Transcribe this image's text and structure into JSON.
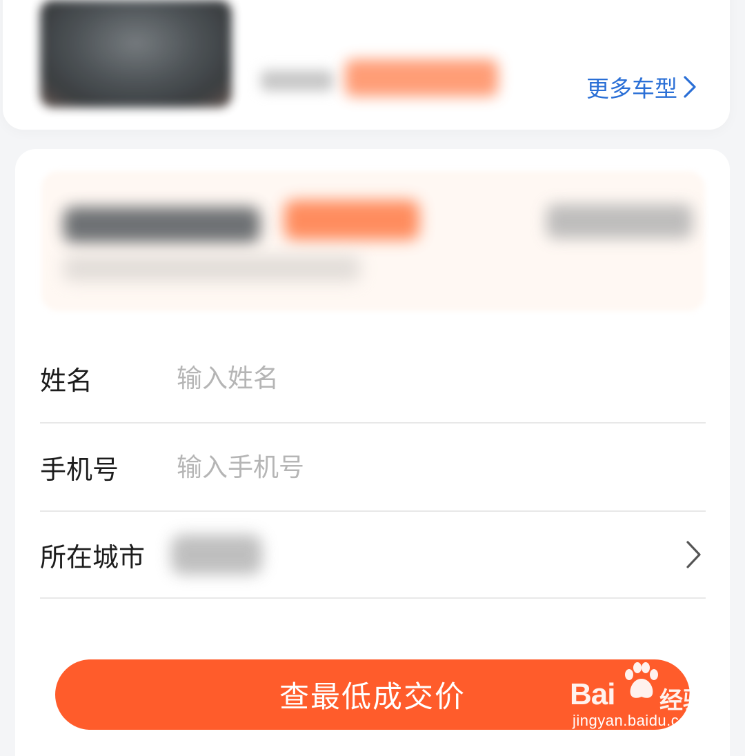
{
  "top_card": {
    "more_models_label": "更多车型",
    "more_models_icon": "chevron-right-icon",
    "link_color": "#2a6fd6"
  },
  "form": {
    "name_label": "姓名",
    "name_placeholder": "输入姓名",
    "phone_label": "手机号",
    "phone_placeholder": "输入手机号",
    "city_label": "所在城市",
    "city_icon": "chevron-right-icon"
  },
  "submit": {
    "label": "查最低成交价",
    "color": "#ff5c2b"
  },
  "watermark": {
    "brand": "Bai",
    "brand_cn": "经验",
    "url": "jingyan.baidu.com"
  }
}
